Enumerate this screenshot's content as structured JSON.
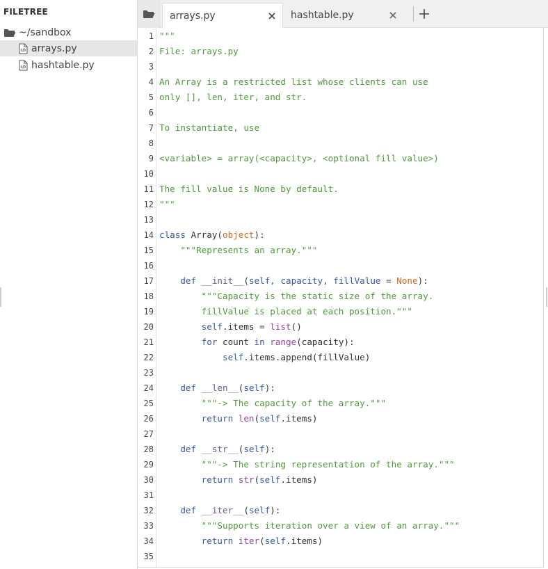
{
  "filetree": {
    "header": "FILETREE",
    "root": {
      "label": "~/sandbox",
      "icon": "folder-open-icon"
    },
    "files": [
      {
        "label": "arrays.py",
        "icon": "code-file-icon",
        "selected": true
      },
      {
        "label": "hashtable.py",
        "icon": "code-file-icon",
        "selected": false
      }
    ]
  },
  "tabs": [
    {
      "label": "arrays.py",
      "active": true
    },
    {
      "label": "hashtable.py",
      "active": false
    }
  ],
  "tab_close_glyph": "✕",
  "tab_add_glyph": "+",
  "editor": {
    "lines": [
      [
        [
          "s",
          "\"\"\""
        ]
      ],
      [
        [
          "s",
          "File: arrays.py"
        ]
      ],
      [],
      [
        [
          "s",
          "An Array is a restricted list whose clients can use"
        ]
      ],
      [
        [
          "s",
          "only [], len, iter, and str."
        ]
      ],
      [],
      [
        [
          "s",
          "To instantiate, use"
        ]
      ],
      [],
      [
        [
          "s",
          "<variable> = array(<capacity>, <optional fill value>)"
        ]
      ],
      [],
      [
        [
          "s",
          "The fill value is None by default."
        ]
      ],
      [
        [
          "s",
          "\"\"\""
        ]
      ],
      [],
      [
        [
          "k",
          "class "
        ],
        [
          "n",
          "Array("
        ],
        [
          "o",
          "object"
        ],
        [
          "n",
          "):"
        ]
      ],
      [
        [
          "n",
          "    "
        ],
        [
          "s",
          "\"\"\"Represents an array.\"\"\""
        ]
      ],
      [],
      [
        [
          "n",
          "    "
        ],
        [
          "d",
          "def "
        ],
        [
          "f",
          "__init__"
        ],
        [
          "n",
          "("
        ],
        [
          "p",
          "self, capacity, fillValue "
        ],
        [
          "n",
          "= "
        ],
        [
          "o",
          "None"
        ],
        [
          "n",
          "):"
        ]
      ],
      [
        [
          "n",
          "        "
        ],
        [
          "s",
          "\"\"\"Capacity is the static size of the array."
        ]
      ],
      [
        [
          "s",
          "        fillValue is placed at each position.\"\"\""
        ]
      ],
      [
        [
          "n",
          "        "
        ],
        [
          "p",
          "self"
        ],
        [
          "n",
          ".items = "
        ],
        [
          "b",
          "list"
        ],
        [
          "n",
          "()"
        ]
      ],
      [
        [
          "n",
          "        "
        ],
        [
          "k",
          "for "
        ],
        [
          "n",
          "count "
        ],
        [
          "k",
          "in "
        ],
        [
          "b",
          "range"
        ],
        [
          "n",
          "(capacity):"
        ]
      ],
      [
        [
          "n",
          "            "
        ],
        [
          "p",
          "self"
        ],
        [
          "n",
          ".items.append(fillValue)"
        ]
      ],
      [],
      [
        [
          "n",
          "    "
        ],
        [
          "d",
          "def "
        ],
        [
          "f",
          "__len__"
        ],
        [
          "n",
          "("
        ],
        [
          "p",
          "self"
        ],
        [
          "n",
          "):"
        ]
      ],
      [
        [
          "n",
          "        "
        ],
        [
          "s",
          "\"\"\"-> The capacity of the array.\"\"\""
        ]
      ],
      [
        [
          "n",
          "        "
        ],
        [
          "k",
          "return "
        ],
        [
          "b",
          "len"
        ],
        [
          "n",
          "("
        ],
        [
          "p",
          "self"
        ],
        [
          "n",
          ".items)"
        ]
      ],
      [],
      [
        [
          "n",
          "    "
        ],
        [
          "d",
          "def "
        ],
        [
          "f",
          "__str__"
        ],
        [
          "n",
          "("
        ],
        [
          "p",
          "self"
        ],
        [
          "n",
          "):"
        ]
      ],
      [
        [
          "n",
          "        "
        ],
        [
          "s",
          "\"\"\"-> The string representation of the array.\"\"\""
        ]
      ],
      [
        [
          "n",
          "        "
        ],
        [
          "k",
          "return "
        ],
        [
          "b",
          "str"
        ],
        [
          "n",
          "("
        ],
        [
          "p",
          "self"
        ],
        [
          "n",
          ".items)"
        ]
      ],
      [],
      [
        [
          "n",
          "    "
        ],
        [
          "d",
          "def "
        ],
        [
          "f",
          "__iter__"
        ],
        [
          "n",
          "("
        ],
        [
          "p",
          "self"
        ],
        [
          "n",
          "):"
        ]
      ],
      [
        [
          "n",
          "        "
        ],
        [
          "s",
          "\"\"\"Supports iteration over a view of an array.\"\"\""
        ]
      ],
      [
        [
          "n",
          "        "
        ],
        [
          "k",
          "return "
        ],
        [
          "b",
          "iter"
        ],
        [
          "n",
          "("
        ],
        [
          "p",
          "self"
        ],
        [
          "n",
          ".items)"
        ]
      ],
      []
    ]
  }
}
